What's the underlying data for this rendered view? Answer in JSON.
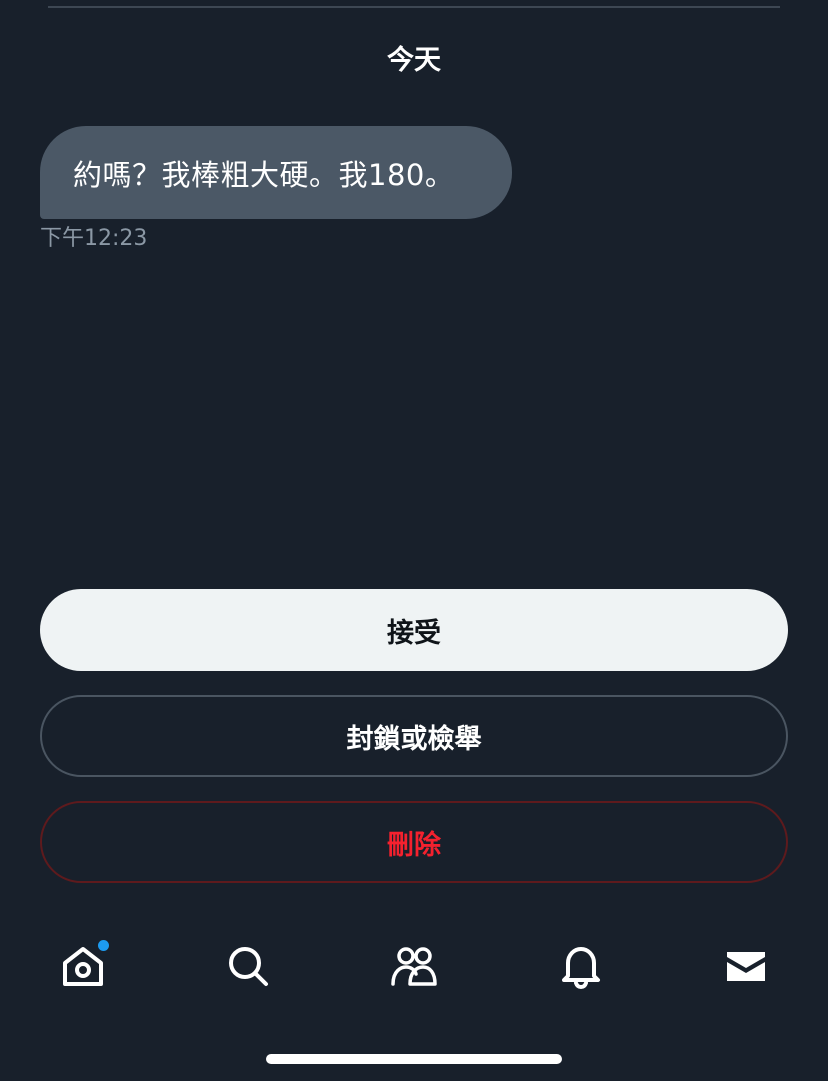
{
  "conversation": {
    "date_header": "今天",
    "messages": [
      {
        "text": "約嗎？我棒粗大硬。我180。",
        "time": "下午12:23"
      }
    ]
  },
  "actions": {
    "accept_label": "接受",
    "block_report_label": "封鎖或檢舉",
    "delete_label": "刪除"
  },
  "nav": {
    "items": [
      {
        "icon": "home-icon",
        "has_notification_dot": true
      },
      {
        "icon": "search-icon",
        "has_notification_dot": false
      },
      {
        "icon": "communities-icon",
        "has_notification_dot": false
      },
      {
        "icon": "bell-icon",
        "has_notification_dot": false
      },
      {
        "icon": "mail-icon",
        "has_notification_dot": false
      }
    ]
  },
  "colors": {
    "background": "#18202b",
    "bubble": "#4b5866",
    "accept_bg": "#eff3f4",
    "delete_text": "#f4212e",
    "notification_dot": "#1d9bf0"
  }
}
